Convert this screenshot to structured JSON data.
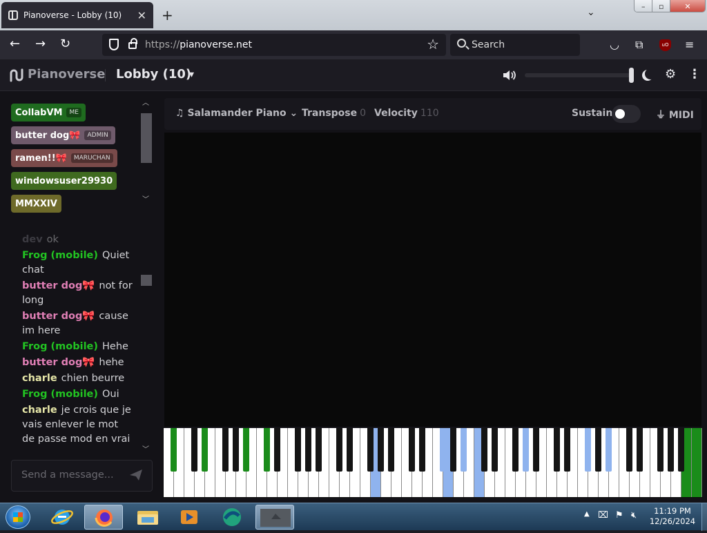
{
  "browser": {
    "tab_title": "Pianoverse - Lobby (10)",
    "url_scheme": "https://",
    "url_host": "pianoverse.net",
    "search_placeholder": "Search",
    "ublock_label": "uO"
  },
  "app": {
    "brand": "Pianoverse",
    "room_title": "Lobby (10)",
    "volume": 0.98
  },
  "users": [
    {
      "name": "CollabVM",
      "tag": "ME",
      "color": "#1f6b1f"
    },
    {
      "name": "butter dog🎀",
      "tag": "ADMIN",
      "color": "#6f5a6b"
    },
    {
      "name": "ramen!!🎀",
      "tag": "MARUCHAN",
      "color": "#7a4a4a"
    },
    {
      "name": "windowsuser29930",
      "tag": "",
      "color": "#3f6a1f"
    },
    {
      "name": "MMXXIV",
      "tag": "",
      "color": "#6e6a2a"
    }
  ],
  "chat": {
    "messages": [
      {
        "name": "dev",
        "text": "ok",
        "color": "#6e6e76",
        "dim": true
      },
      {
        "name": "Frog (mobile)",
        "text": "Quiet chat",
        "color": "#22c322"
      },
      {
        "name": "butter dog🎀",
        "text": "not for long",
        "color": "#e07fb5"
      },
      {
        "name": "butter dog🎀",
        "text": "cause im here",
        "color": "#e07fb5"
      },
      {
        "name": "Frog (mobile)",
        "text": "Hehe",
        "color": "#22c322"
      },
      {
        "name": "butter dog🎀",
        "text": "hehe",
        "color": "#e07fb5"
      },
      {
        "name": "charle",
        "text": "chien beurre",
        "color": "#e6e6a8"
      },
      {
        "name": "Frog (mobile)",
        "text": "Oui",
        "color": "#22c322"
      },
      {
        "name": "charle",
        "text": "je crois que je vais enlever le mot de passe mod en vrai",
        "color": "#e6e6a8"
      }
    ],
    "input_placeholder": "Send a message..."
  },
  "toolbar": {
    "instrument": "Salamander Piano",
    "transpose_label": "Transpose",
    "transpose_value": "0",
    "velocity_label": "Velocity",
    "velocity_value": "110",
    "sustain_label": "Sustain",
    "midi_label": "MIDI"
  },
  "taskbar": {
    "time": "11:19 PM",
    "date": "12/26/2024"
  },
  "colors": {
    "key_green": "#1a8c1a",
    "key_blue": "#8fb3ee"
  }
}
